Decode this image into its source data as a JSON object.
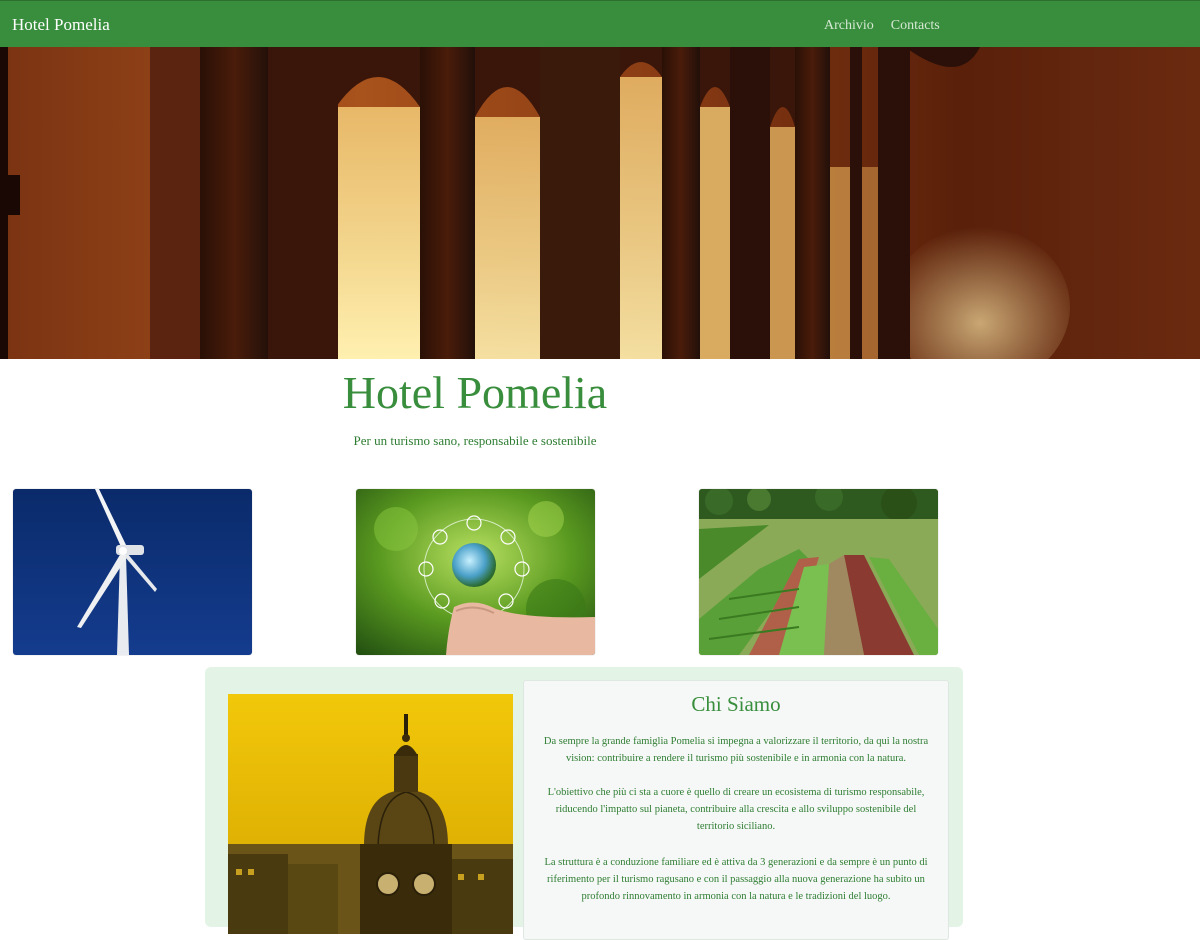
{
  "navbar": {
    "brand": "Hotel Pomelia",
    "links": [
      "Archivio",
      "Contacts"
    ],
    "background": "#388e3c"
  },
  "hero": {
    "title": "Hotel Pomelia",
    "tagline": "Per un turismo sano, responsabile e sostenibile"
  },
  "cards": [
    {
      "image": "wind-turbine-photo"
    },
    {
      "image": "green-energy-hand-photo"
    },
    {
      "image": "vegetable-garden-photo"
    }
  ],
  "about": {
    "title": "Chi Siamo",
    "paragraphs": [
      "Da sempre la grande famiglia Pomelia si impegna a valorizzare il territorio, da qui la nostra vision: contribuire a rendere il turismo più sostenibile e in armonia con la natura.",
      "L'obiettivo che più ci sta a cuore è quello di creare un ecosistema di turismo responsabile, riducendo l'impatto sul pianeta, contribuire alla crescita e allo sviluppo sostenibile del territorio siciliano.",
      "La struttura è a conduzione familiare ed è attiva da 3 generazioni e da sempre è un punto di riferimento per il turismo ragusano e con il passaggio alla nuova generazione ha subito un profondo rinnovamento in armonia con la natura e le tradizioni del luogo."
    ]
  },
  "colors": {
    "accent": "#388e3c",
    "text_green": "#2e7d32",
    "panel_bg": "#e3f4e6"
  }
}
